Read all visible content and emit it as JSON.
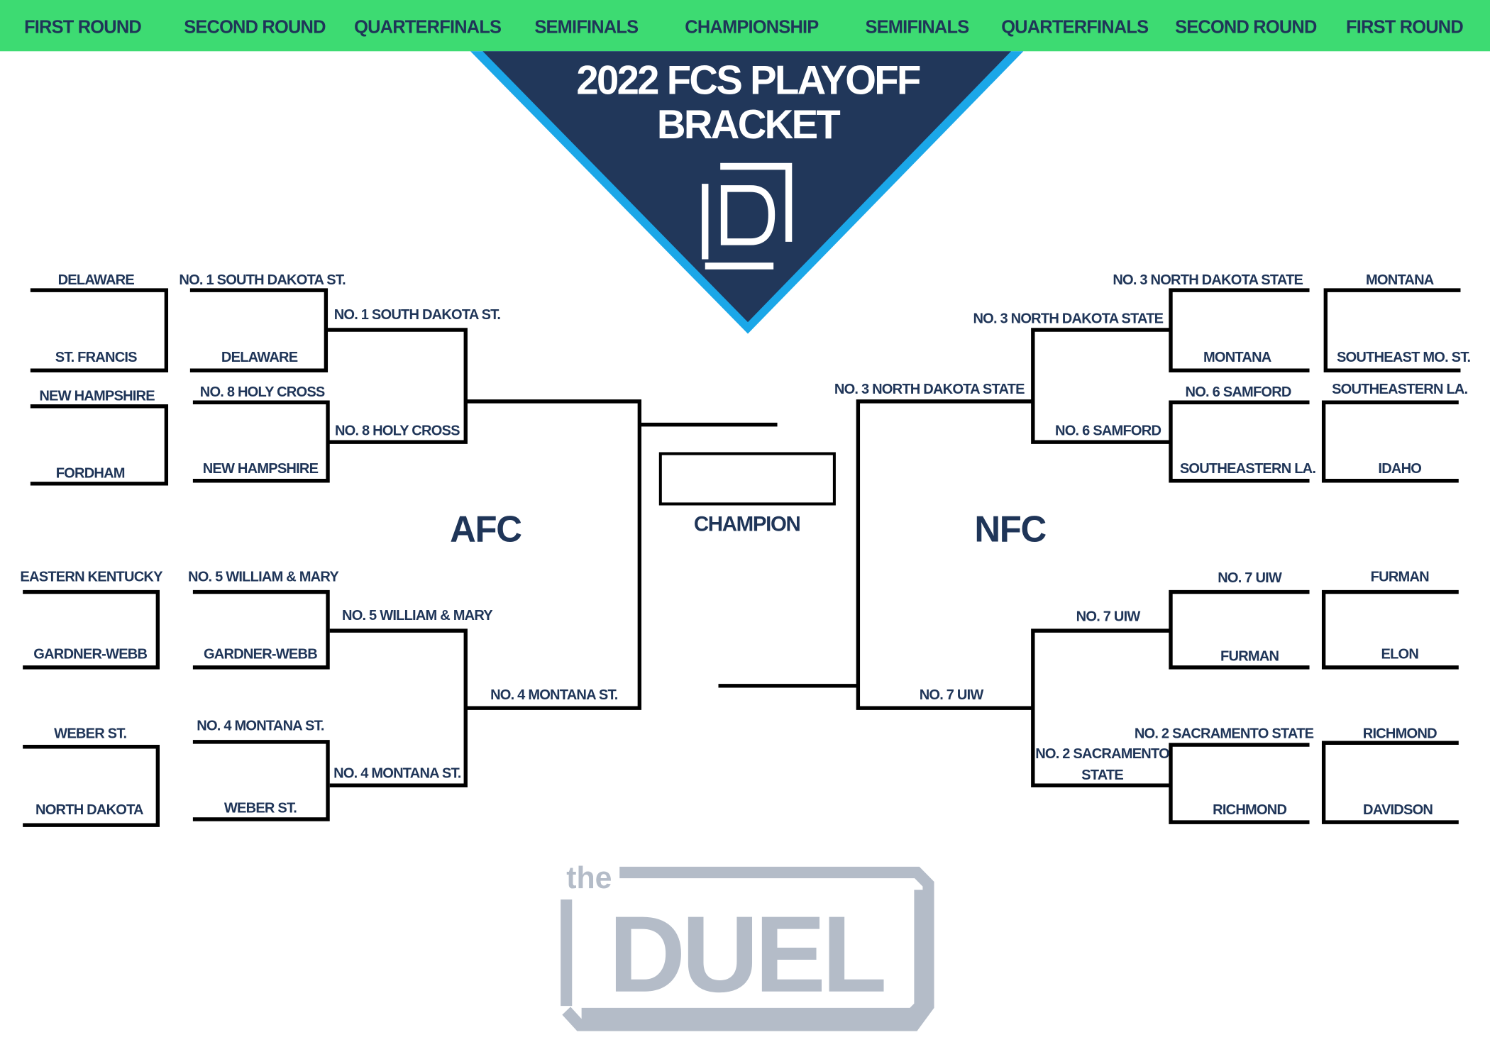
{
  "header": {
    "rounds": [
      "FIRST ROUND",
      "SECOND ROUND",
      "QUARTERFINALS",
      "SEMIFINALS",
      "CHAMPIONSHIP",
      "SEMIFINALS",
      "QUARTERFINALS",
      "SECOND ROUND",
      "FIRST ROUND"
    ],
    "bg_color": "#3ddb72"
  },
  "title": {
    "line1": "2022 FCS PLAYOFF",
    "line2": "BRACKET",
    "banner_color": "#21375a",
    "border_color": "#1ba7e8"
  },
  "conferences": {
    "left": "AFC",
    "right": "NFC"
  },
  "champion": {
    "label": "CHAMPION",
    "value": ""
  },
  "left": {
    "first_round": [
      [
        "DELAWARE",
        "ST. FRANCIS"
      ],
      [
        "NEW HAMPSHIRE",
        "FORDHAM"
      ],
      [
        "EASTERN KENTUCKY",
        "GARDNER-WEBB"
      ],
      [
        "WEBER ST.",
        "NORTH DAKOTA"
      ]
    ],
    "second_round": [
      [
        "NO. 1 SOUTH DAKOTA ST.",
        "DELAWARE"
      ],
      [
        "NO. 8 HOLY CROSS",
        "NEW HAMPSHIRE"
      ],
      [
        "NO. 5 WILLIAM & MARY",
        "GARDNER-WEBB"
      ],
      [
        "NO. 4 MONTANA ST.",
        "WEBER ST."
      ]
    ],
    "quarterfinals": [
      [
        "NO. 1 SOUTH DAKOTA ST.",
        "NO. 8 HOLY CROSS"
      ],
      [
        "NO. 5 WILLIAM & MARY",
        "NO. 4 MONTANA ST."
      ]
    ],
    "semifinal_bottom": "NO. 4 MONTANA ST."
  },
  "right": {
    "first_round": [
      [
        "MONTANA",
        "SOUTHEAST MO. ST."
      ],
      [
        "SOUTHEASTERN LA.",
        "IDAHO"
      ],
      [
        "FURMAN",
        "ELON"
      ],
      [
        "RICHMOND",
        "DAVIDSON"
      ]
    ],
    "second_round": [
      [
        "NO. 3 NORTH DAKOTA STATE",
        "MONTANA"
      ],
      [
        "NO. 6 SAMFORD",
        "SOUTHEASTERN LA."
      ],
      [
        "NO. 7 UIW",
        "FURMAN"
      ],
      [
        "NO. 2 SACRAMENTO STATE",
        "RICHMOND"
      ]
    ],
    "quarterfinals": [
      [
        "NO. 3 NORTH DAKOTA STATE",
        "NO. 6 SAMFORD"
      ],
      [
        "NO. 7 UIW",
        "NO. 2 SACRAMENTO",
        "STATE"
      ]
    ],
    "semifinals": [
      "NO. 3 NORTH DAKOTA STATE",
      "NO. 7 UIW"
    ]
  },
  "logo": {
    "the": "the",
    "name": "DUEL",
    "color": "#b4bcc8"
  }
}
